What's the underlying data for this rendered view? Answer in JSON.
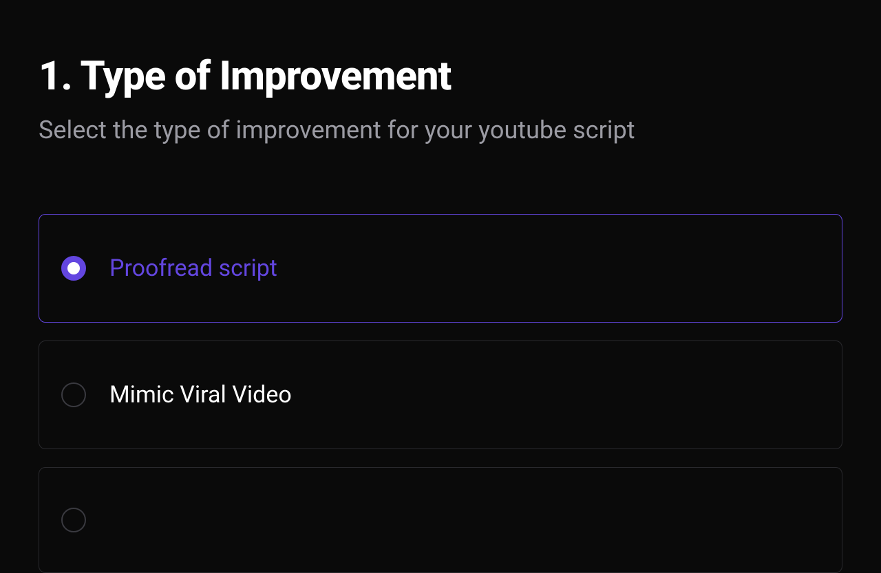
{
  "heading": {
    "title": "1. Type of Improvement",
    "subtitle": "Select the type of improvement for your youtube script"
  },
  "options": [
    {
      "label": "Proofread script",
      "selected": true
    },
    {
      "label": "Mimic Viral Video",
      "selected": false
    },
    {
      "label": "",
      "selected": false
    }
  ],
  "colors": {
    "background": "#0a0a0a",
    "accent": "#6346e0",
    "text_primary": "#ffffff",
    "text_muted": "#9b9ba3",
    "border_default": "#2a2a2e"
  }
}
